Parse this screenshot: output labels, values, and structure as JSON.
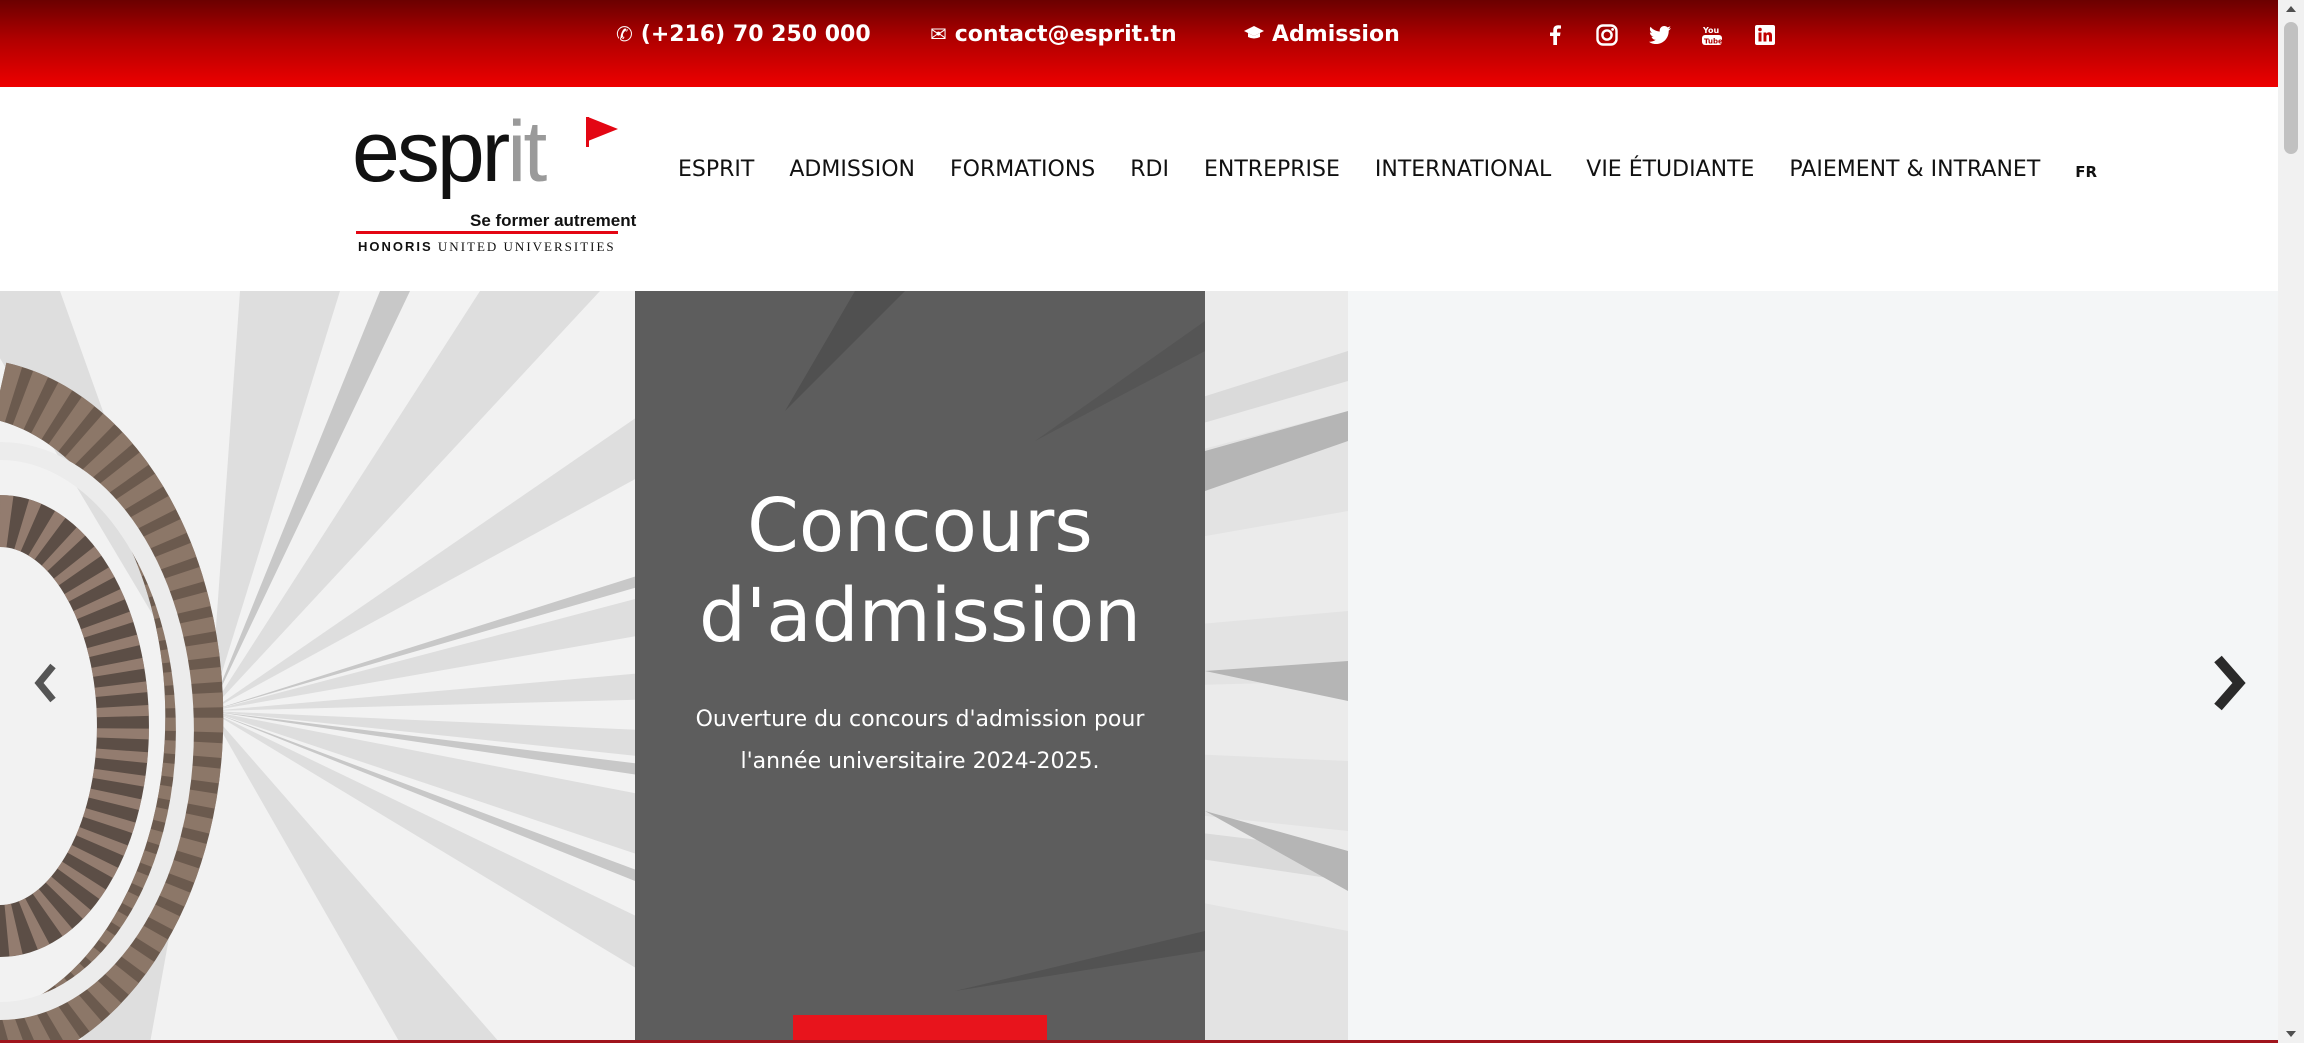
{
  "topbar": {
    "phone": "(+216) 70 250 000",
    "email": "contact@esprit.tn",
    "admission": "Admission",
    "icons": {
      "phone": "phone-icon",
      "email": "envelope-icon",
      "admission": "graduation-cap-icon"
    },
    "social": [
      "facebook-icon",
      "instagram-icon",
      "twitter-icon",
      "youtube-icon",
      "linkedin-icon"
    ]
  },
  "logo": {
    "word_dark": "espr",
    "word_grey": "it",
    "tagline": "Se former autrement",
    "honoris_bold": "HONORIS",
    "honoris_rest": " UNITED UNIVERSITIES"
  },
  "nav": {
    "items": [
      "ESPRIT",
      "ADMISSION",
      "FORMATIONS",
      "RDI",
      "ENTREPRISE",
      "INTERNATIONAL",
      "VIE ÉTUDIANTE",
      "PAIEMENT & INTRANET"
    ],
    "lang": "FR"
  },
  "hero": {
    "title_line1": "Concours",
    "title_line2": "d'admission",
    "subtitle_line1": "Ouverture du concours d'admission pour",
    "subtitle_line2": "l'année universitaire 2024-2025.",
    "button_label": ""
  },
  "colors": {
    "brand_red": "#e30613",
    "topbar_dark": "#6b0000",
    "card_grey": "#5d5d5d",
    "button_red": "#e8141c"
  }
}
